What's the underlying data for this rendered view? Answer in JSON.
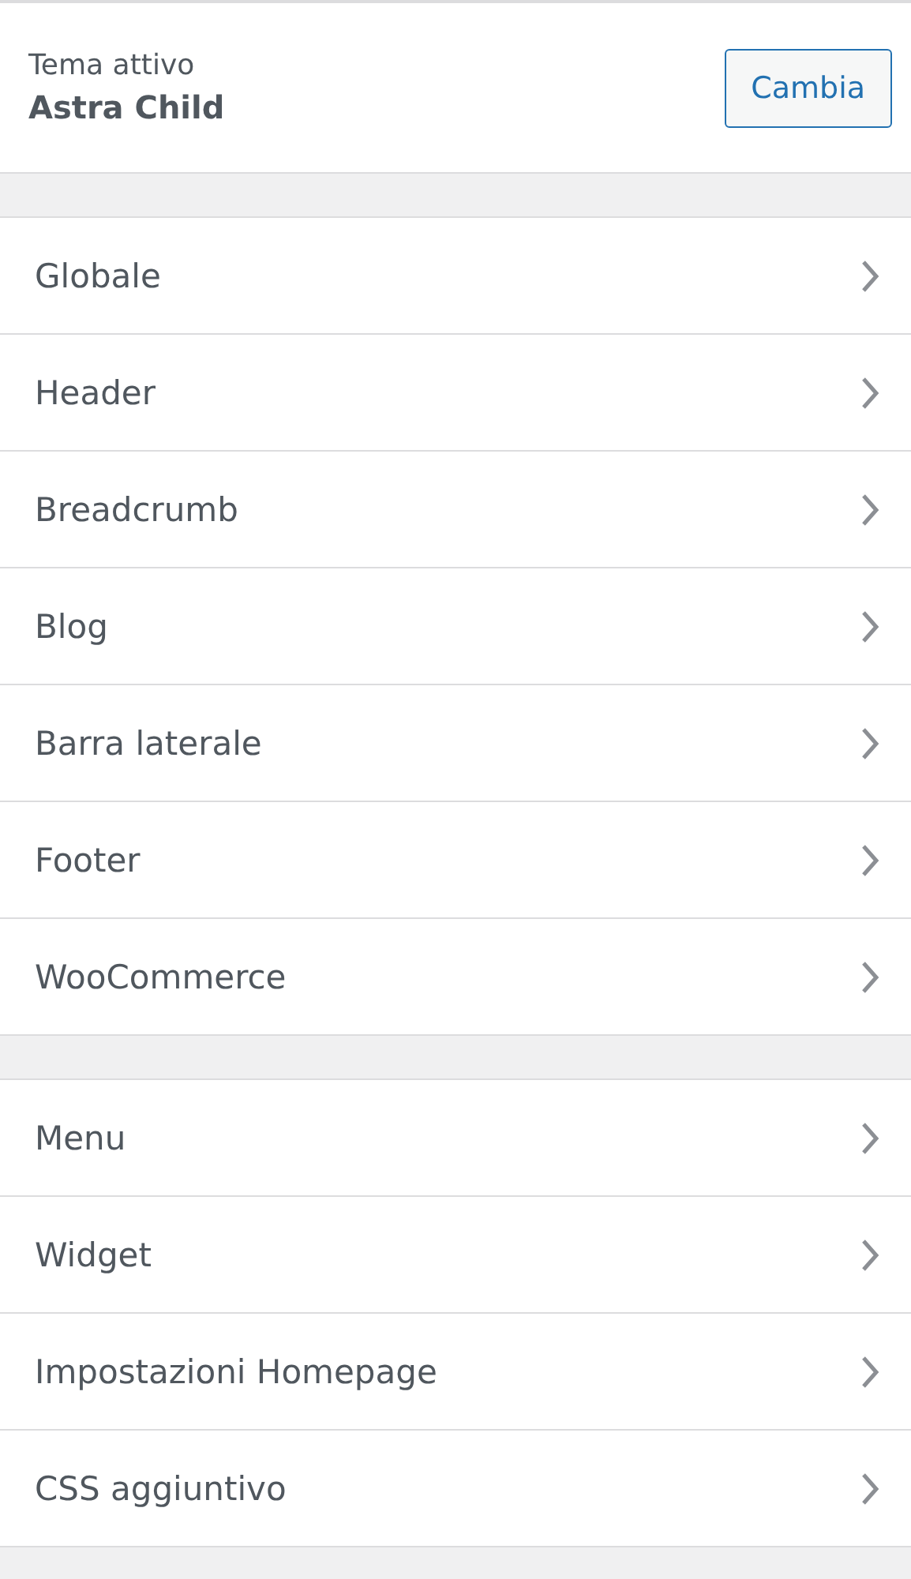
{
  "active_theme": {
    "label": "Tema attivo",
    "name": "Astra Child",
    "button": "Cambia"
  },
  "sections": [
    {
      "items": [
        {
          "label": "Globale"
        },
        {
          "label": "Header"
        },
        {
          "label": "Breadcrumb"
        },
        {
          "label": "Blog"
        },
        {
          "label": "Barra laterale"
        },
        {
          "label": "Footer"
        },
        {
          "label": "WooCommerce"
        }
      ]
    },
    {
      "items": [
        {
          "label": "Menu"
        },
        {
          "label": "Widget"
        },
        {
          "label": "Impostazioni Homepage"
        },
        {
          "label": "CSS aggiuntivo"
        }
      ]
    }
  ]
}
